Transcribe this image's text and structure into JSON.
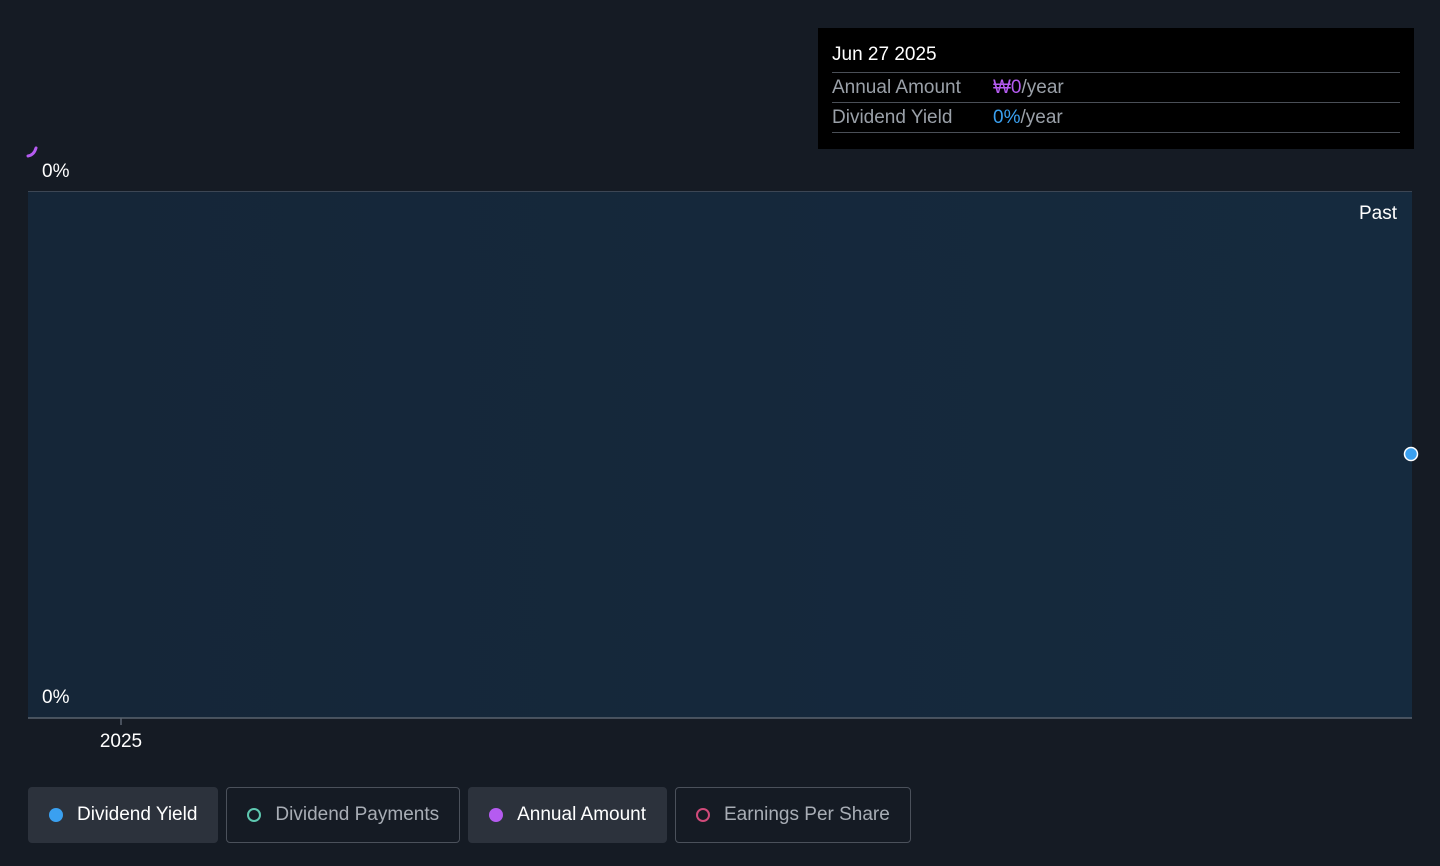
{
  "chart_data": {
    "type": "line",
    "title": "",
    "xlabel": "",
    "ylabel": "",
    "x_ticks": [
      "2025"
    ],
    "y_top_label": "0%",
    "y_bottom_label": "0%",
    "annual_amount_label": "0%",
    "region_label": "Past",
    "series": [
      {
        "name": "Dividend Yield",
        "color": "#3aa0f0",
        "points": [
          {
            "x": "2025-06-27",
            "y": 0
          }
        ]
      },
      {
        "name": "Annual Amount",
        "color": "#b55bf0",
        "points": [
          {
            "x": "2025-06-27",
            "y": 0
          }
        ]
      }
    ]
  },
  "tooltip": {
    "date": "Jun 27 2025",
    "rows": [
      {
        "label": "Annual Amount",
        "value": "₩0",
        "unit": "/year"
      },
      {
        "label": "Dividend Yield",
        "value": "0%",
        "unit": "/year"
      }
    ]
  },
  "legend": {
    "items": [
      {
        "label": "Dividend Yield",
        "color": "#3aa0f0",
        "active": true
      },
      {
        "label": "Dividend Payments",
        "color": "#5ec8b0",
        "active": false
      },
      {
        "label": "Annual Amount",
        "color": "#b55bf0",
        "active": true
      },
      {
        "label": "Earnings Per Share",
        "color": "#d04a7a",
        "active": false
      }
    ]
  }
}
